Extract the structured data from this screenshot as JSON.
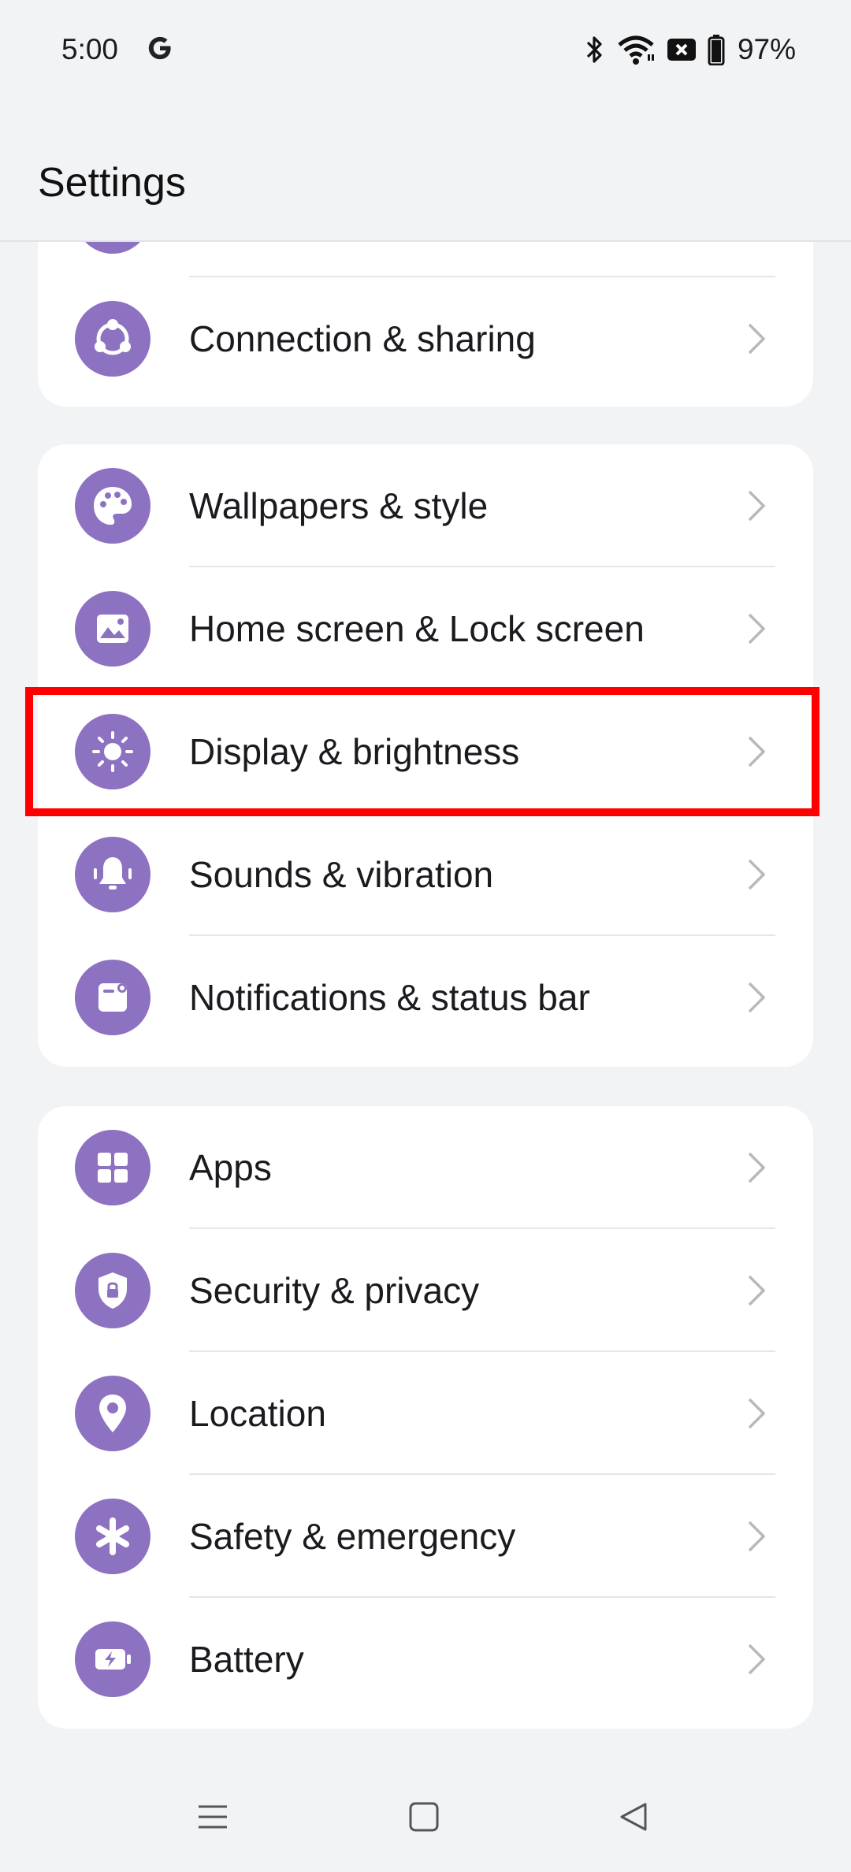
{
  "status_bar": {
    "time": "5:00",
    "battery_percent": "97%",
    "icons": [
      "google-icon",
      "bluetooth-icon",
      "wifi-icon",
      "signal-off-icon",
      "battery-icon"
    ]
  },
  "header": {
    "title": "Settings"
  },
  "groups": [
    {
      "items": [
        {
          "label": "Connection & sharing",
          "icon": "share-network-icon"
        }
      ]
    },
    {
      "items": [
        {
          "label": "Wallpapers & style",
          "icon": "palette-icon"
        },
        {
          "label": "Home screen & Lock screen",
          "icon": "image-icon"
        },
        {
          "label": "Display & brightness",
          "icon": "sun-icon"
        },
        {
          "label": "Sounds & vibration",
          "icon": "bell-icon"
        },
        {
          "label": "Notifications & status bar",
          "icon": "notification-icon"
        }
      ]
    },
    {
      "items": [
        {
          "label": "Apps",
          "icon": "grid-icon"
        },
        {
          "label": "Security & privacy",
          "icon": "shield-lock-icon"
        },
        {
          "label": "Location",
          "icon": "location-pin-icon"
        },
        {
          "label": "Safety & emergency",
          "icon": "asterisk-icon"
        },
        {
          "label": "Battery",
          "icon": "battery-charge-icon"
        }
      ]
    }
  ],
  "highlighted_item": "Display & brightness",
  "colors": {
    "accent": "#8e72c2",
    "highlight": "#ff0000",
    "background": "#f2f3f5"
  },
  "nav_bar": {
    "buttons": [
      "menu-icon",
      "home-icon",
      "back-icon"
    ]
  }
}
